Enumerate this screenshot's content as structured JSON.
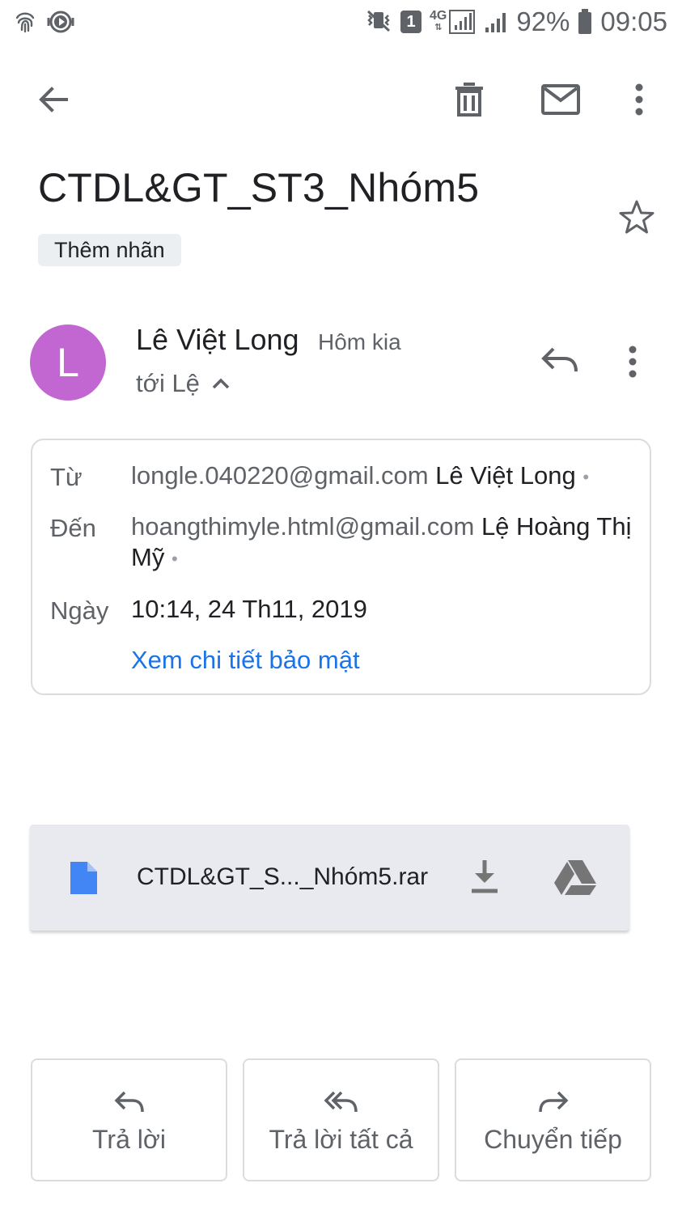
{
  "status_bar": {
    "battery": "92%",
    "time": "09:05",
    "sim": "1",
    "network": "4G"
  },
  "toolbar": {
    "back_icon": "arrow-back-icon",
    "delete_icon": "trash-icon",
    "mark_unread_icon": "mail-icon",
    "more_icon": "more-vert-icon"
  },
  "email": {
    "subject": "CTDL&GT_ST3_Nhóm5",
    "label_chip": "Thêm nhãn",
    "sender": {
      "initial": "L",
      "avatar_color": "#c266d2",
      "name": "Lê Việt Long",
      "time": "Hôm kia",
      "to_line": "tới Lệ"
    },
    "details": {
      "from_label": "Từ",
      "from_email": "longle.040220@gmail.com",
      "from_name": "Lê Việt Long",
      "to_label": "Đến",
      "to_email": "hoangthimyle.html@gmail.com",
      "to_name": "Lệ Hoàng Thị Mỹ",
      "date_label": "Ngày",
      "date_value": "10:14, 24 Th11, 2019",
      "security_link": "Xem chi tiết bảo mật"
    },
    "attachment": {
      "file_name": "CTDL&GT_S..._Nhóm5.rar",
      "file_icon": "file-icon",
      "download_icon": "download-icon",
      "drive_icon": "drive-icon"
    }
  },
  "actions": {
    "reply": "Trả lời",
    "reply_all": "Trả lời tất cả",
    "forward": "Chuyển tiếp"
  },
  "colors": {
    "accent_link": "#1a73e8",
    "file_icon_blue": "#4285f4",
    "attachment_bg": "#e8eaf0"
  }
}
